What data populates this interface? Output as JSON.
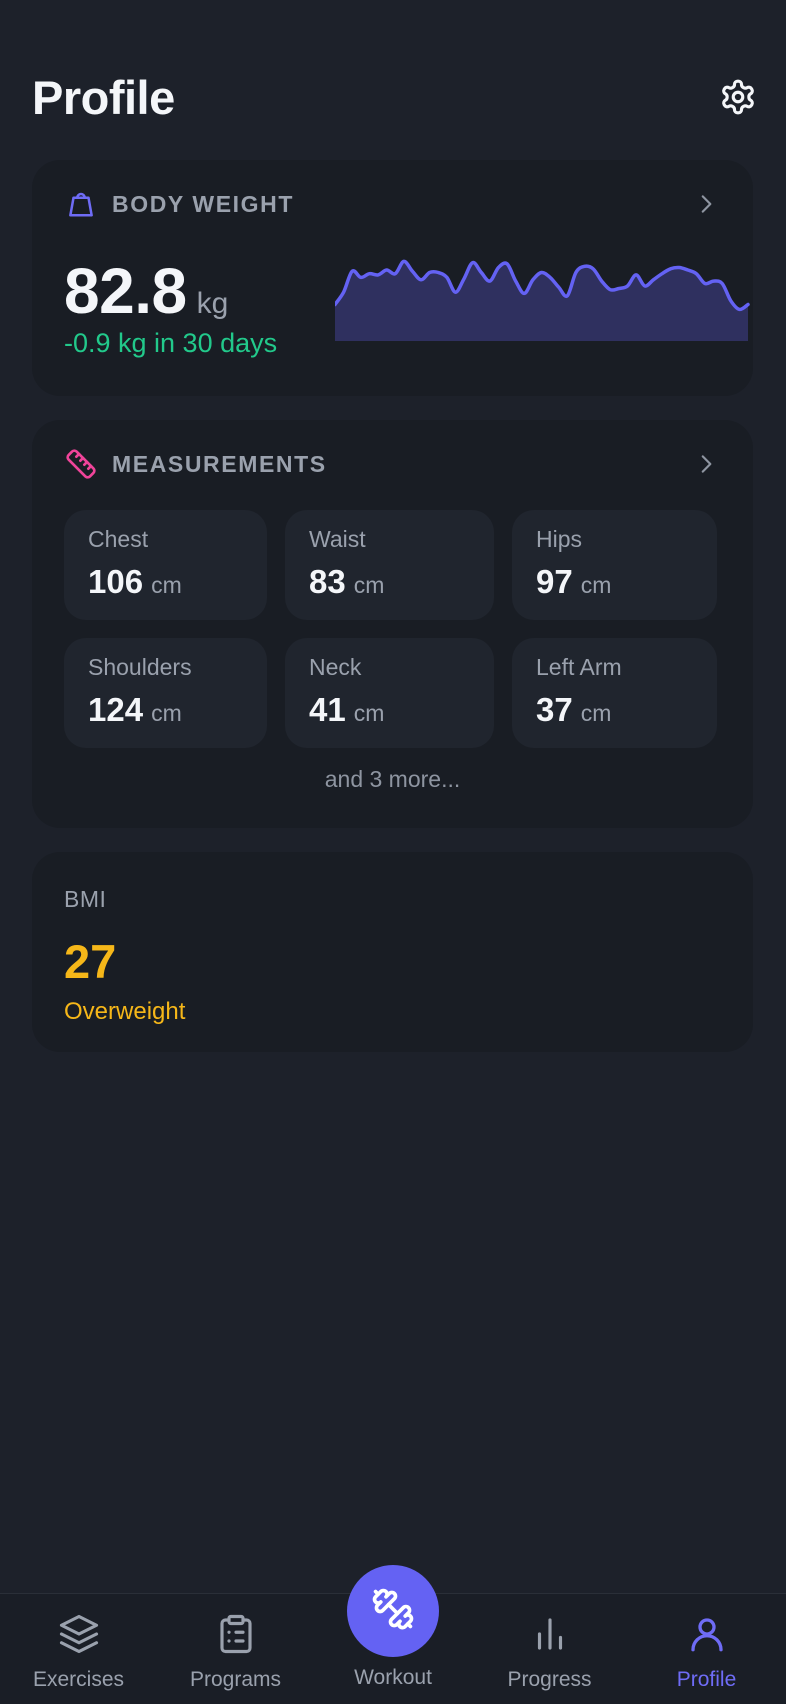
{
  "header": {
    "title": "Profile",
    "settings_icon": "gear-icon"
  },
  "body_weight": {
    "title": "BODY WEIGHT",
    "icon": "weight-icon",
    "value": "82.8",
    "unit": "kg",
    "change": "-0.9 kg in 30 days",
    "colors": {
      "line": "#6462f3",
      "fill": "#34346a",
      "change": "#22c98b"
    },
    "trend": [
      80.9,
      81.9,
      83.6,
      83.1,
      83.4,
      83.3,
      83.7,
      83.4,
      84.4,
      83.6,
      82.9,
      83.5,
      83.5,
      83.1,
      81.9,
      83.0,
      84.3,
      83.5,
      82.8,
      83.9,
      84.2,
      82.8,
      81.8,
      82.9,
      83.5,
      83.1,
      82.3,
      81.6,
      83.5,
      84.0,
      83.8,
      82.8,
      82.1,
      82.2,
      82.4,
      83.3,
      82.4,
      82.9,
      83.4,
      83.8,
      83.9,
      83.7,
      83.4,
      82.6,
      82.8,
      82.6,
      81.2,
      80.5,
      80.9
    ]
  },
  "measurements": {
    "title": "MEASUREMENTS",
    "icon": "ruler-icon",
    "items": [
      {
        "label": "Chest",
        "value": "106",
        "unit": "cm"
      },
      {
        "label": "Waist",
        "value": "83",
        "unit": "cm"
      },
      {
        "label": "Hips",
        "value": "97",
        "unit": "cm"
      },
      {
        "label": "Shoulders",
        "value": "124",
        "unit": "cm"
      },
      {
        "label": "Neck",
        "value": "41",
        "unit": "cm"
      },
      {
        "label": "Left Arm",
        "value": "37",
        "unit": "cm"
      }
    ],
    "more": "and 3 more..."
  },
  "bmi": {
    "label": "BMI",
    "value": "27",
    "status": "Overweight",
    "color": "#f6b719"
  },
  "nav": {
    "items": [
      {
        "label": "Exercises",
        "icon": "layers-icon"
      },
      {
        "label": "Programs",
        "icon": "clipboard-list-icon"
      },
      {
        "label": "Workout",
        "icon": "dumbbell-icon"
      },
      {
        "label": "Progress",
        "icon": "bar-chart-icon"
      },
      {
        "label": "Profile",
        "icon": "user-icon",
        "active": true
      }
    ],
    "active_color": "#6f6cf6"
  }
}
